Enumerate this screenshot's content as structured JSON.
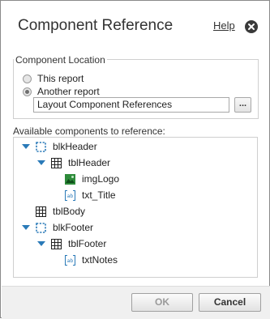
{
  "dialog": {
    "title": "Component Reference",
    "help_label": "Help"
  },
  "location": {
    "legend": "Component Location",
    "options": [
      {
        "label": "This report",
        "selected": false
      },
      {
        "label": "Another report",
        "selected": true
      }
    ],
    "report_value": "Layout Component References",
    "browse_label": "..."
  },
  "components": {
    "label": "Available components to reference:",
    "tree": [
      {
        "label": "blkHeader",
        "icon": "block-icon",
        "expanded": true,
        "level": 0
      },
      {
        "label": "tblHeader",
        "icon": "table-icon",
        "expanded": true,
        "level": 1
      },
      {
        "label": "imgLogo",
        "icon": "image-icon",
        "level": 2
      },
      {
        "label": "txt_Title",
        "icon": "text-field-icon",
        "level": 2
      },
      {
        "label": "tblBody",
        "icon": "table-icon",
        "level": 0
      },
      {
        "label": "blkFooter",
        "icon": "block-icon",
        "expanded": true,
        "level": 0
      },
      {
        "label": "tblFooter",
        "icon": "table-icon",
        "expanded": true,
        "level": 1
      },
      {
        "label": "txtNotes",
        "icon": "text-field-icon",
        "level": 2
      }
    ]
  },
  "buttons": {
    "ok_label": "OK",
    "cancel_label": "Cancel"
  },
  "colors": {
    "tree_accent": "#2a7ab8",
    "image_icon": "#2e8b3a"
  }
}
